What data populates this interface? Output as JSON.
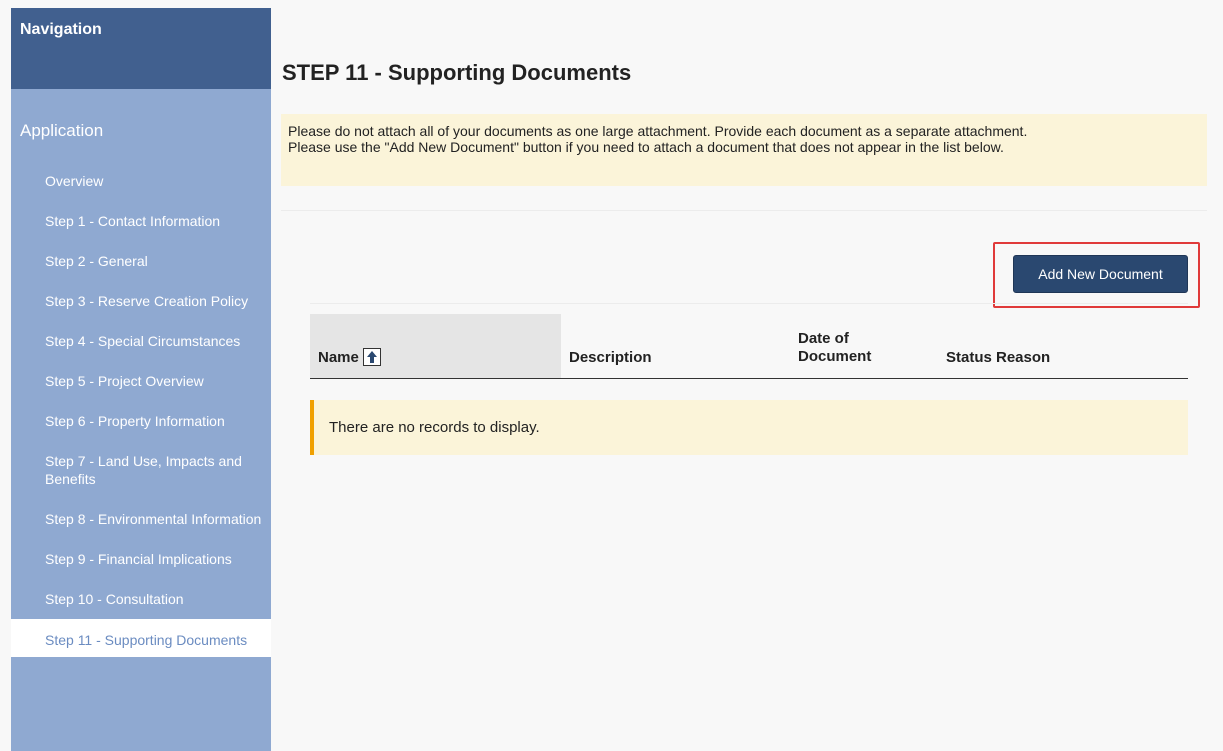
{
  "sidebar": {
    "header": "Navigation",
    "section": "Application",
    "items": [
      {
        "label": "Overview"
      },
      {
        "label": "Step 1 - Contact Information"
      },
      {
        "label": "Step 2 - General"
      },
      {
        "label": "Step 3 - Reserve Creation Policy"
      },
      {
        "label": "Step 4 - Special Circumstances"
      },
      {
        "label": "Step 5 - Project Overview"
      },
      {
        "label": "Step 6 - Property Information"
      },
      {
        "label": "Step 7 - Land Use, Impacts and Benefits"
      },
      {
        "label": "Step 8 - Environmental Information"
      },
      {
        "label": "Step 9 - Financial Implications"
      },
      {
        "label": "Step 10 - Consultation"
      },
      {
        "label": "Step 11 - Supporting Documents"
      }
    ]
  },
  "main": {
    "title": "STEP 11 - Supporting Documents",
    "notice_line1": "Please do not attach all of your documents as one large attachment. Provide each document as a separate attachment.",
    "notice_line2": "Please use the \"Add New Document\" button if you need to attach a document that does not appear in the list below.",
    "add_button": "Add New Document",
    "table": {
      "columns": [
        "Name",
        "Description",
        "Date of Document",
        "Status Reason"
      ],
      "date_col_line1": "Date of",
      "date_col_line2": "Document",
      "sort_icon": "arrow-up-icon",
      "empty_message": "There are no records to display."
    }
  },
  "colors": {
    "nav_header": "#41608f",
    "sidebar": "#8fa9d1",
    "button": "#2a4870",
    "notice_bg": "#fbf4d9",
    "highlight": "#e03a3a"
  }
}
